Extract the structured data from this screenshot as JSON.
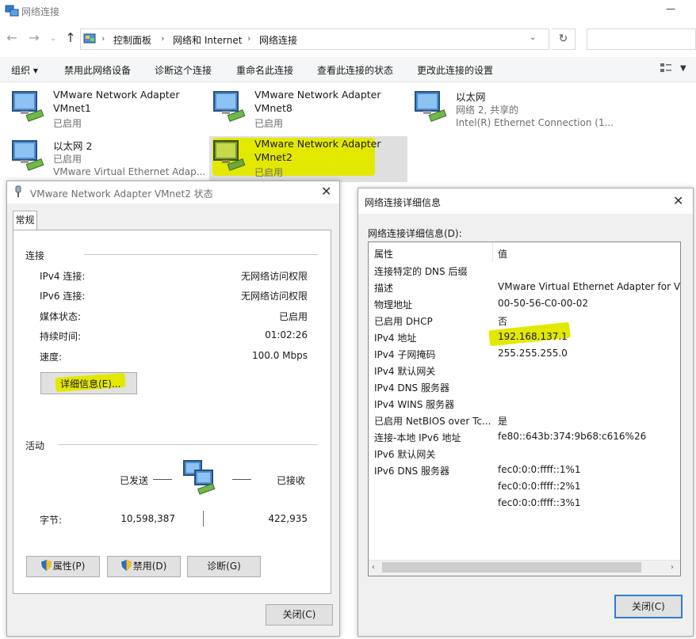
{
  "explorer": {
    "title": "网络连接",
    "minimize_glyph": "—",
    "breadcrumb": [
      "控制面板",
      "网络和 Internet",
      "网络连接"
    ],
    "commands": [
      "组织 ▾",
      "禁用此网络设备",
      "诊断这个连接",
      "重命名此连接",
      "查看此连接的状态",
      "更改此连接的设置"
    ],
    "adapters": [
      {
        "line1": "VMware Network Adapter",
        "line2": "VMnet1",
        "line3": "已启用"
      },
      {
        "line1": "VMware Network Adapter",
        "line2": "VMnet8",
        "line3": "已启用"
      },
      {
        "line1": "以太网",
        "line2": "网络 2, 共享的",
        "line3": "Intel(R) Ethernet Connection (1..."
      },
      {
        "line1": "以太网 2",
        "line2": "已启用",
        "line3": "VMware Virtual Ethernet Adap..."
      },
      {
        "line1": "VMware Network Adapter",
        "line2": "VMnet2",
        "line3": "已启用",
        "selected": true
      }
    ]
  },
  "status_dialog": {
    "title": "VMware Network Adapter VMnet2 状态",
    "tab": "常规",
    "connection_section": "连接",
    "rows": [
      {
        "key": "IPv4 连接:",
        "value": "无网络访问权限"
      },
      {
        "key": "IPv6 连接:",
        "value": "无网络访问权限"
      },
      {
        "key": "媒体状态:",
        "value": "已启用"
      },
      {
        "key": "持续时间:",
        "value": "01:02:26"
      },
      {
        "key": "速度:",
        "value": "100.0 Mbps"
      }
    ],
    "details_button": "详细信息(E)...",
    "activity_section": "活动",
    "sent_label": "已发送",
    "received_label": "已接收",
    "bytes_label": "字节:",
    "bytes_sent": "10,598,387",
    "bytes_received": "422,935",
    "buttons": {
      "properties": "属性(P)",
      "disable": "禁用(D)",
      "diagnose": "诊断(G)"
    },
    "close": "关闭(C)"
  },
  "details_dialog": {
    "title": "网络连接详细信息",
    "label": "网络连接详细信息(D):",
    "col_property": "属性",
    "col_value": "值",
    "rows": [
      {
        "prop": "连接特定的 DNS 后缀",
        "value": ""
      },
      {
        "prop": "描述",
        "value": "VMware Virtual Ethernet Adapter for VM"
      },
      {
        "prop": "物理地址",
        "value": "00-50-56-C0-00-02"
      },
      {
        "prop": "已启用 DHCP",
        "value": "否"
      },
      {
        "prop": "IPv4 地址",
        "value": "192.168.137.1"
      },
      {
        "prop": "IPv4 子网掩码",
        "value": "255.255.255.0"
      },
      {
        "prop": "IPv4 默认网关",
        "value": ""
      },
      {
        "prop": "IPv4 DNS 服务器",
        "value": ""
      },
      {
        "prop": "IPv4 WINS 服务器",
        "value": ""
      },
      {
        "prop": "已启用 NetBIOS over Tc...",
        "value": "是"
      },
      {
        "prop": "连接-本地 IPv6 地址",
        "value": "fe80::643b:374:9b68:c616%26"
      },
      {
        "prop": "IPv6 默认网关",
        "value": ""
      },
      {
        "prop": "IPv6 DNS 服务器",
        "value": "fec0:0:0:ffff::1%1"
      },
      {
        "prop": "",
        "value": "fec0:0:0:ffff::2%1"
      },
      {
        "prop": "",
        "value": "fec0:0:0:ffff::3%1"
      }
    ],
    "close": "关闭(C)"
  },
  "colors": {
    "highlight": "#e3e800",
    "selection": "#dfdfdf",
    "default_button_border": "#2d7dd2"
  }
}
